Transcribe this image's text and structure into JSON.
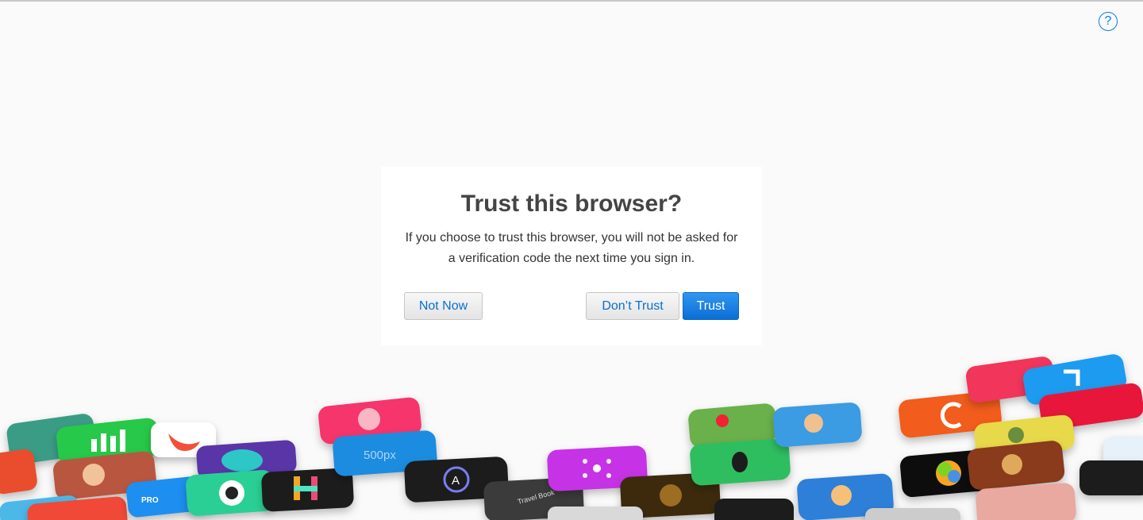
{
  "help": {
    "icon": "question-mark-icon",
    "glyph": "?"
  },
  "dialog": {
    "title": "Trust this browser?",
    "body": "If you choose to trust this browser, you will not be asked for a verification code the next time you sign in.",
    "buttons": {
      "not_now": "Not Now",
      "dont_trust": "Don’t Trust",
      "trust": "Trust"
    }
  },
  "colors": {
    "accent": "#0a7ae6",
    "primary_button": "#1a82e8",
    "background": "#fafafa"
  },
  "app_icons": {
    "label_500px": "500px",
    "label_travel_book": "Travel Book"
  }
}
